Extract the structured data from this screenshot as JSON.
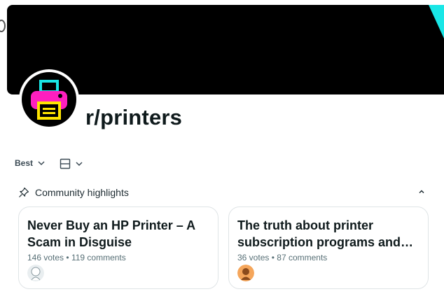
{
  "subreddit": {
    "name": "r/printers"
  },
  "icons": {
    "avatar": "printer-icon",
    "sort": "chevron-down-icon",
    "view": "view-layout-icon",
    "pin": "pin-icon",
    "collapse": "chevron-up-icon"
  },
  "colors": {
    "banner": "#000000",
    "accent_cyan": "#19e6e6",
    "accent_magenta": "#ff1fbf",
    "accent_yellow": "#ffe500"
  },
  "controls": {
    "sort_label": "Best"
  },
  "highlights": {
    "title": "Community highlights",
    "cards": [
      {
        "title": "Never Buy an HP Printer – A Scam in Disguise",
        "votes": "146 votes",
        "comments": "119 comments"
      },
      {
        "title": "The truth about printer subscription programs and…",
        "votes": "36 votes",
        "comments": "87 comments"
      }
    ]
  },
  "meta_separator": "•"
}
